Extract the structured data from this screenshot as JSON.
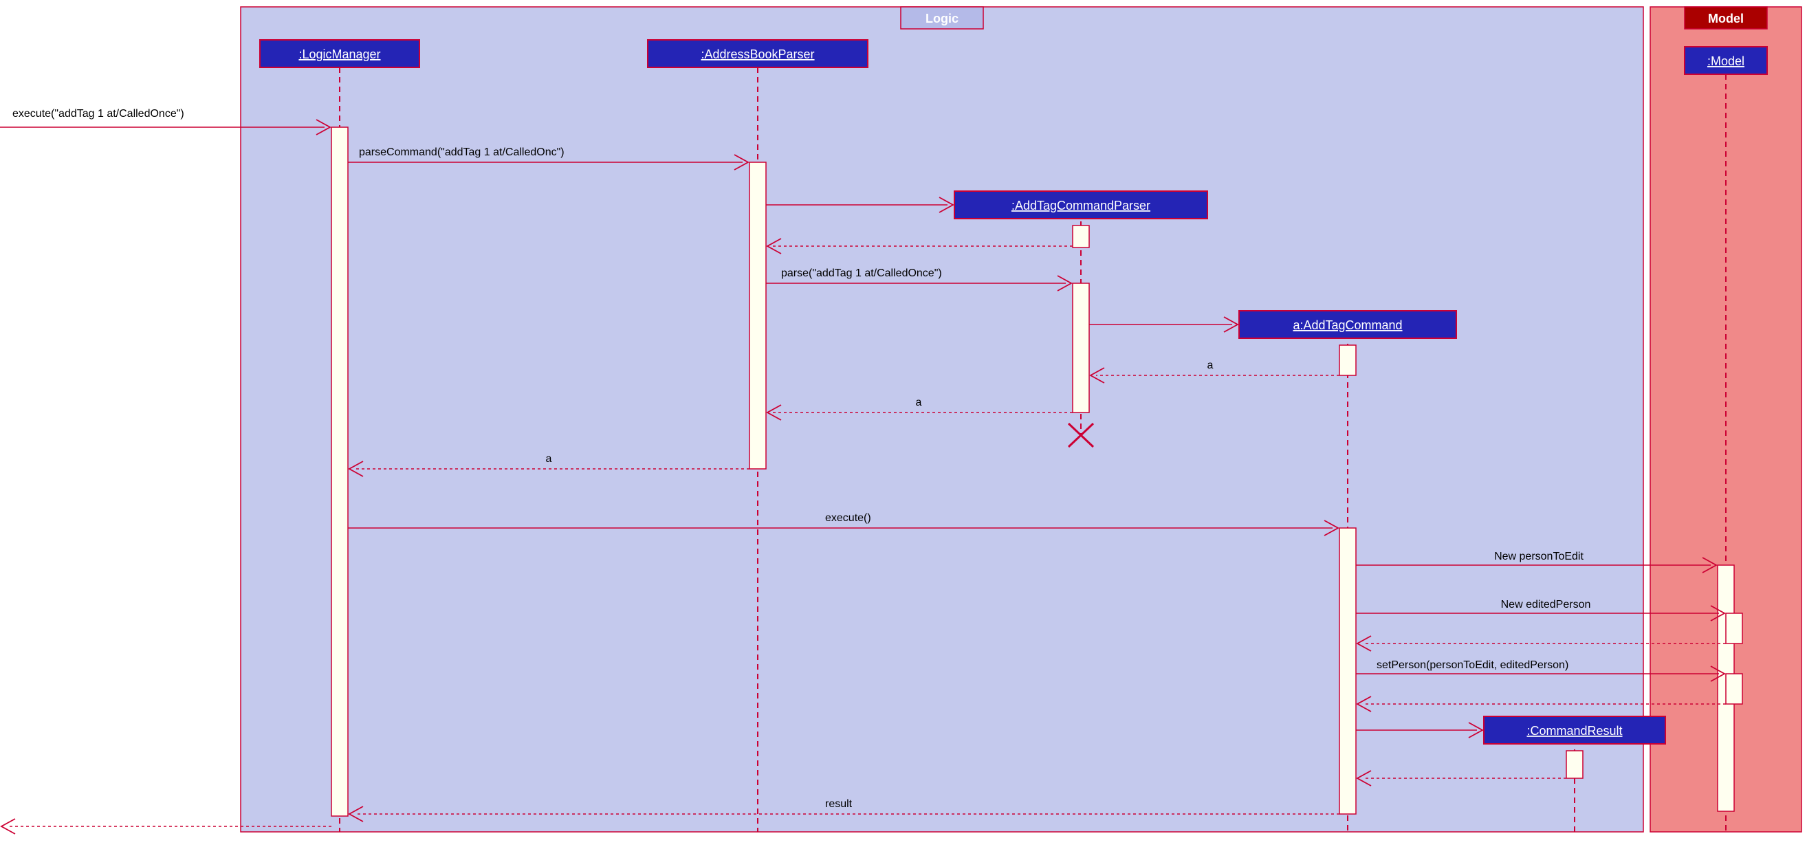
{
  "frames": {
    "logic": "Logic",
    "model": "Model"
  },
  "participants": {
    "logicManager": ":LogicManager",
    "addressBookParser": ":AddressBookParser",
    "addTagCommandParser": ":AddTagCommandParser",
    "addTagCommand": "a:AddTagCommand",
    "commandResult": ":CommandResult",
    "model": ":Model"
  },
  "messages": {
    "m1": "execute(\"addTag 1 at/CalledOnce\")",
    "m2": "parseCommand(\"addTag 1 at/CalledOnc\")",
    "m3": "parse(\"addTag 1 at/CalledOnce\")",
    "m4a": "a",
    "m4b": "a",
    "m4c": "a",
    "m5": "execute()",
    "m6": "New personToEdit",
    "m7": "New editedPerson",
    "m8": "setPerson(personToEdit, editedPerson)",
    "m9": "result"
  }
}
